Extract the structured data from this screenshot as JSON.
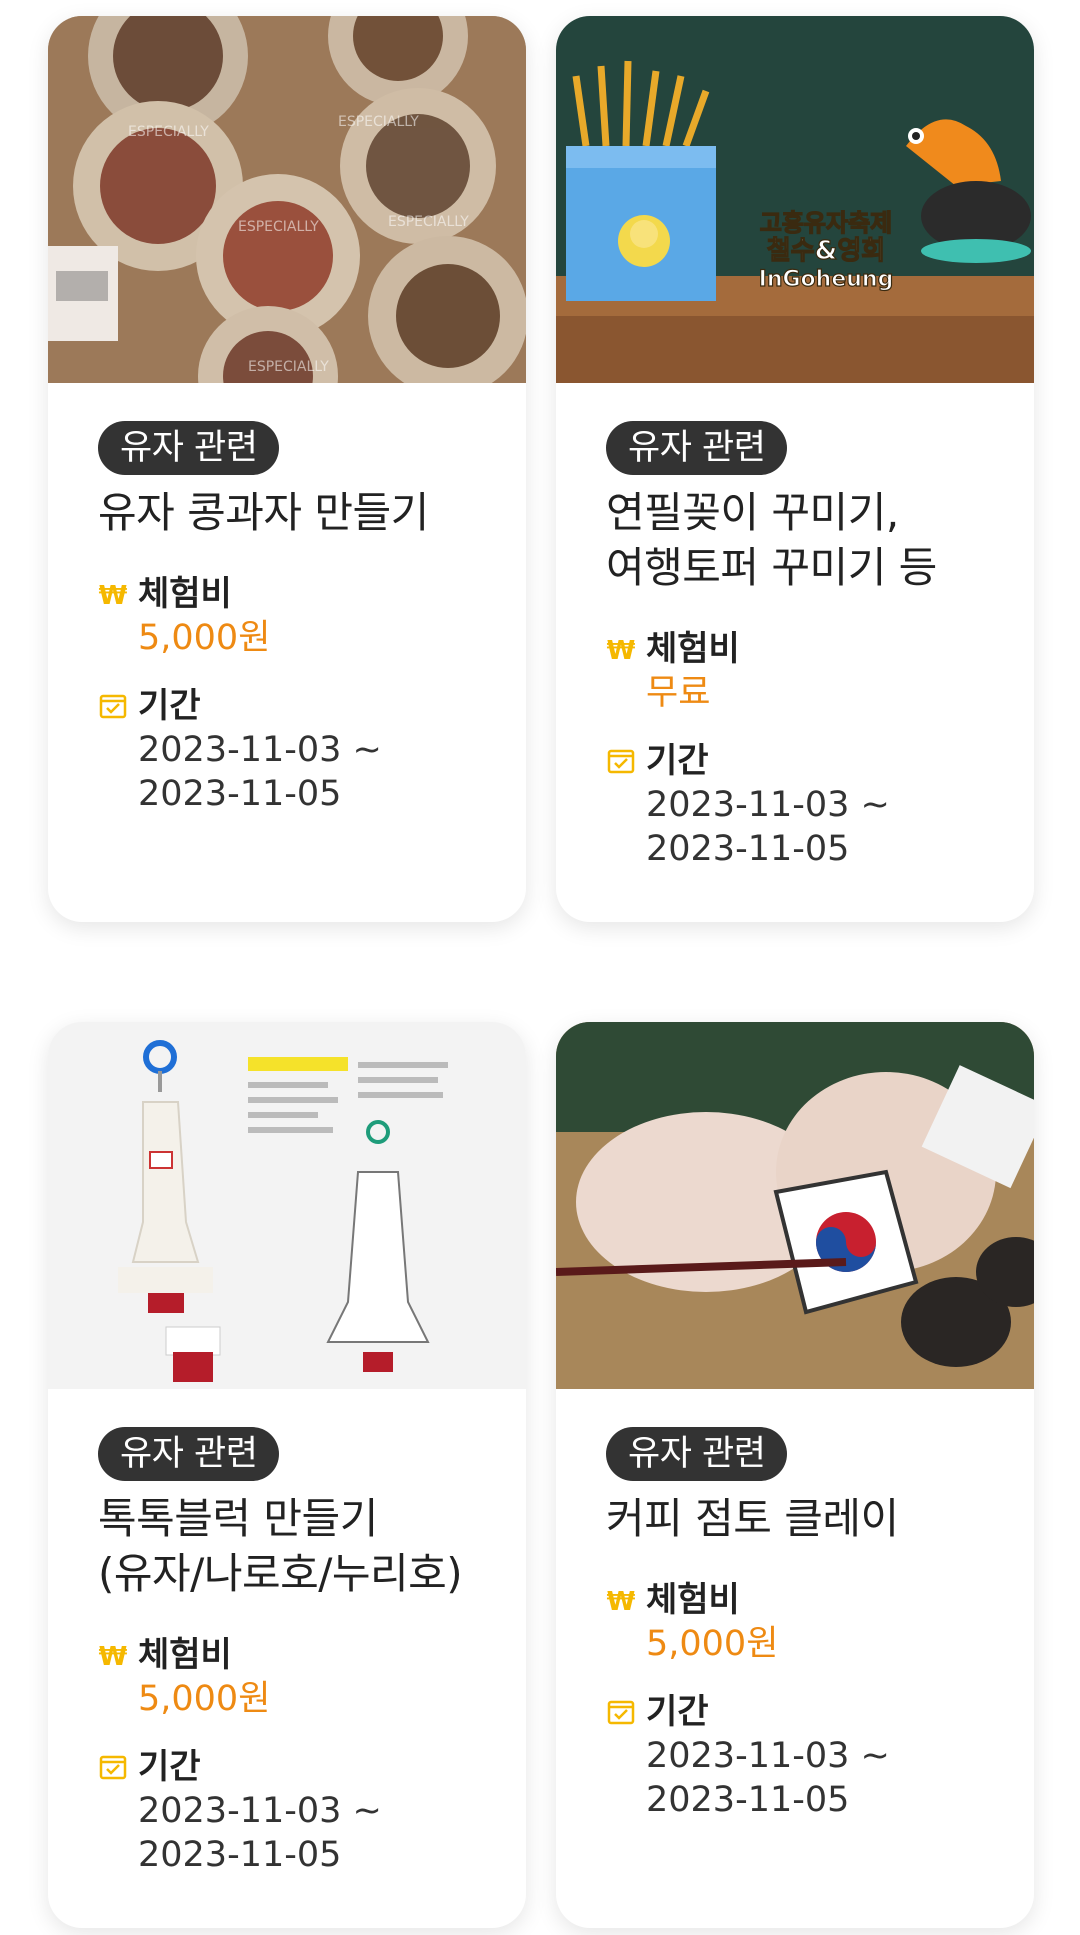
{
  "cards": [
    {
      "image": "yuja-bean-cookies-photo",
      "category": "유자 관련",
      "title": "유자 콩과자 만들기",
      "fee_label": "체험비",
      "fee_value": "5,000원",
      "period_label": "기간",
      "period_start": "2023-11-03 ~",
      "period_end": "2023-11-05"
    },
    {
      "image": "pencil-holder-festival-photo",
      "image_text": [
        "고흥유자축제",
        "철수&영희",
        "InGoheung"
      ],
      "category": "유자 관련",
      "title": "연필꽂이 꾸미기, 여행토퍼 꾸미기 등",
      "fee_label": "체험비",
      "fee_value": "무료",
      "period_label": "기간",
      "period_start": "2023-11-03 ~",
      "period_end": "2023-11-05"
    },
    {
      "image": "block-keyring-kit-photo",
      "category": "유자 관련",
      "title": "톡톡블럭 만들기 (유자/나로호/누리호)",
      "fee_label": "체험비",
      "fee_value": "5,000원",
      "period_label": "기간",
      "period_start": "2023-11-03 ~",
      "period_end": "2023-11-05"
    },
    {
      "image": "coffee-clay-painting-photo",
      "category": "유자 관련",
      "title": "커피 점토 클레이",
      "fee_label": "체험비",
      "fee_value": "5,000원",
      "period_label": "기간",
      "period_start": "2023-11-03 ~",
      "period_end": "2023-11-05"
    }
  ],
  "colors": {
    "accent": "#ee8a13",
    "icon": "#f5b800",
    "badge_bg": "#333333"
  },
  "icons": {
    "fee": "won-icon",
    "period": "calendar-check-icon"
  }
}
